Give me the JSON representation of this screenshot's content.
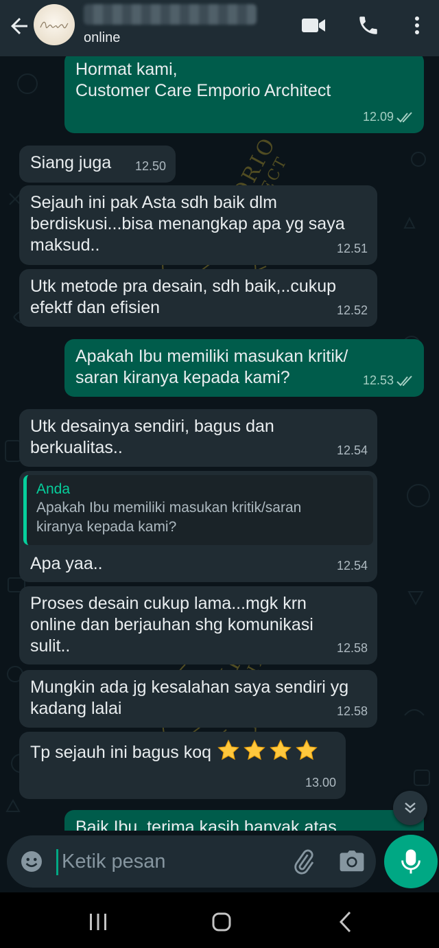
{
  "header": {
    "status": "online",
    "icons": [
      "back-arrow-icon",
      "avatar",
      "video-call-icon",
      "phone-icon",
      "more-vert-icon"
    ]
  },
  "messages": [
    {
      "direction": "out",
      "text": "Hormat kami,\nCustomer Care Emporio Architect",
      "time": "12.09",
      "read": true
    },
    {
      "direction": "in",
      "text": "Siang juga",
      "time": "12.50"
    },
    {
      "direction": "in",
      "text": "Sejauh ini pak Asta sdh baik dlm\nberdiskusi...bisa menangkap apa yg saya\nmaksud..",
      "time": "12.51"
    },
    {
      "direction": "in",
      "text": "Utk metode pra desain, sdh baik,..cukup\nefektf dan efisien",
      "time": "12.52"
    },
    {
      "direction": "out",
      "text": "Apakah Ibu memiliki masukan kritik/\nsaran kiranya kepada kami?",
      "time": "12.53",
      "read": true
    },
    {
      "direction": "in",
      "text": "Utk desainya sendiri, bagus dan\nberkualitas..",
      "time": "12.54"
    },
    {
      "direction": "in",
      "text": "Apa yaa..",
      "time": "12.54",
      "quote": {
        "author": "Anda",
        "text": "Apakah Ibu memiliki masukan kritik/saran\nkiranya kepada kami?"
      }
    },
    {
      "direction": "in",
      "text": "Proses desain cukup lama...mgk krn\nonline dan berjauhan shg komunikasi\nsulit..",
      "time": "12.58"
    },
    {
      "direction": "in",
      "text": "Mungkin ada jg kesalahan saya sendiri yg\nkadang lalai",
      "time": "12.58"
    },
    {
      "direction": "in",
      "text": "Tp sejauh ini bagus koq",
      "time": "13.00",
      "stars": 4
    },
    {
      "direction": "out",
      "text": "Baik Ibu, terima kasih banyak atas",
      "partial": true
    }
  ],
  "input": {
    "placeholder": "Ketik pesan"
  },
  "colors": {
    "background": "#0b141a",
    "header": "#1f2c34",
    "incoming_bubble": "#202c33",
    "outgoing_bubble": "#005c4b",
    "accent": "#00a884",
    "quote_author": "#06cf9c",
    "star": "#ffc83d",
    "watermark": "#8a7a2a"
  }
}
